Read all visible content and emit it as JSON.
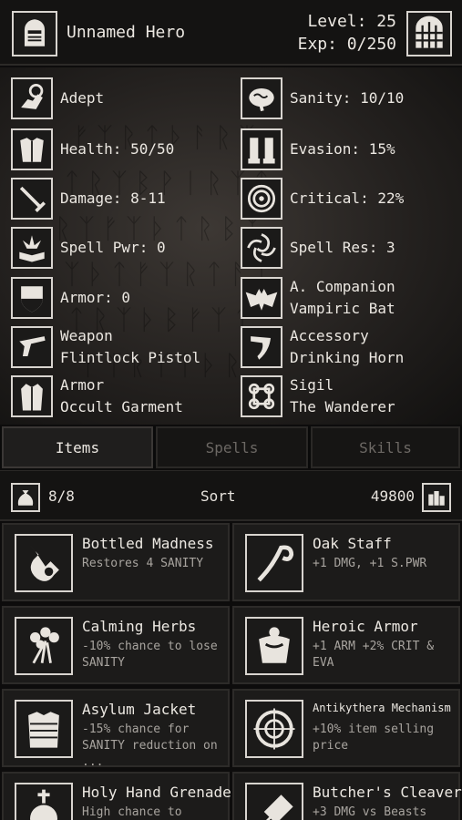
{
  "header": {
    "hero_name": "Unnamed Hero",
    "level": "Level: 25",
    "exp": "Exp: 0/250",
    "icons": {
      "hero": "knight-helmet-icon",
      "gate": "castle-gate-icon"
    }
  },
  "stats": {
    "left": [
      {
        "icon": "rune-hand-icon",
        "line1": "Adept"
      },
      {
        "icon": "chest-armor-icon",
        "line1": "Health: 50/50"
      },
      {
        "icon": "sword-icon",
        "line1": "Damage: 8-11"
      },
      {
        "icon": "spellbook-icon",
        "line1": "Spell Pwr: 0"
      },
      {
        "icon": "shield-icon",
        "line1": "Armor: 0"
      },
      {
        "icon": "pistol-icon",
        "line1": "Weapon",
        "line2": "Flintlock Pistol"
      },
      {
        "icon": "coat-icon",
        "line1": "Armor",
        "line2": "Occult Garment"
      }
    ],
    "right": [
      {
        "icon": "brain-icon",
        "line1": "Sanity: 10/10"
      },
      {
        "icon": "boots-icon",
        "line1": "Evasion: 15%"
      },
      {
        "icon": "target-icon",
        "line1": "Critical: 22%"
      },
      {
        "icon": "vortex-icon",
        "line1": "Spell Res: 3"
      },
      {
        "icon": "bat-icon",
        "line1": "A. Companion",
        "line2": "Vampiric Bat"
      },
      {
        "icon": "horn-icon",
        "line1": "Accessory",
        "line2": "Drinking Horn"
      },
      {
        "icon": "sigil-icon",
        "line1": "Sigil",
        "line2": "The Wanderer"
      }
    ]
  },
  "tabs": [
    {
      "label": "Items",
      "active": true
    },
    {
      "label": "Spells",
      "active": false
    },
    {
      "label": "Skills",
      "active": false
    }
  ],
  "toolbar": {
    "bag_count": "8/8",
    "sort_label": "Sort",
    "gold": "49800",
    "icons": {
      "bag": "money-bag-icon",
      "coins": "coin-stack-icon"
    }
  },
  "items": [
    {
      "name": "Bottled Madness",
      "desc": "Restores 4 SANITY",
      "icon": "potion-bottle-icon"
    },
    {
      "name": "Oak Staff",
      "desc": "+1 DMG, +1 S.PWR",
      "icon": "staff-icon"
    },
    {
      "name": "Calming Herbs",
      "desc": "-10% chance to lose SANITY",
      "icon": "herbs-icon"
    },
    {
      "name": "Heroic Armor",
      "desc": "+1 ARM +2% CRIT & EVA",
      "icon": "heroic-armor-icon"
    },
    {
      "name": "Asylum Jacket",
      "desc": "-15% chance for SANITY reduction on ...",
      "icon": "straitjacket-icon"
    },
    {
      "name": "Antikythera Mechanism",
      "desc": "+10% item selling price",
      "icon": "mechanism-icon"
    },
    {
      "name": "Holy Hand Grenade",
      "desc": "High chance to",
      "icon": "grenade-icon"
    },
    {
      "name": "Butcher's Cleaver",
      "desc": "+3 DMG vs Beasts",
      "icon": "cleaver-icon"
    }
  ]
}
